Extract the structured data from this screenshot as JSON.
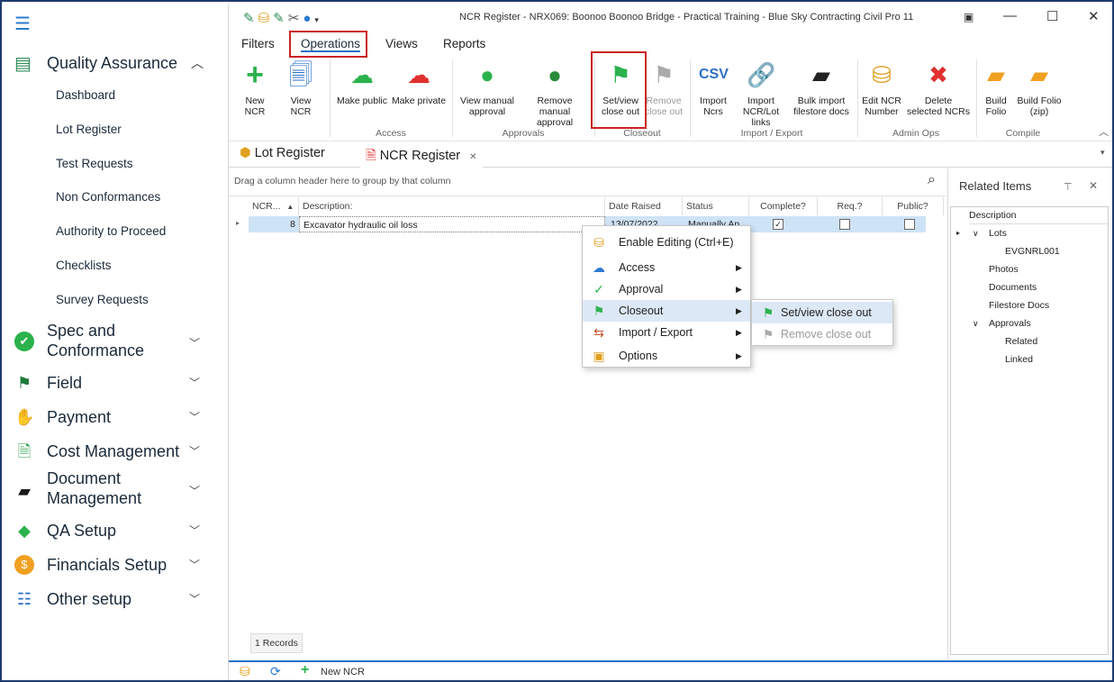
{
  "window": {
    "title": "NCR Register - NRX069: Boonoo Boonoo Bridge - Practical Training - Blue Sky Contracting Civil Pro 11",
    "qat_icons": [
      "edit-icon",
      "db-icon",
      "user-edit-icon",
      "tools-icon",
      "user-icon",
      "dropdown-icon"
    ]
  },
  "sidebar": {
    "section": "Quality Assurance",
    "sub_items": [
      "Dashboard",
      "Lot Register",
      "Test Requests",
      "Non Conformances",
      "Authority to Proceed",
      "Checklists",
      "Survey Requests"
    ],
    "groups": [
      {
        "label": "Spec and\nConformance",
        "label_line1": "Spec and",
        "label_line2": "Conformance",
        "icon": "check-circle-icon"
      },
      {
        "label": "Field",
        "icon": "flag-icon"
      },
      {
        "label": "Payment",
        "icon": "payment-icon"
      },
      {
        "label": "Cost Management",
        "icon": "cost-icon"
      },
      {
        "label": "Document Management",
        "label_line1": "Document",
        "label_line2": "Management",
        "icon": "folder-icon"
      },
      {
        "label": "QA Setup",
        "icon": "tag-icon"
      },
      {
        "label": "Financials Setup",
        "icon": "dollar-icon"
      },
      {
        "label": "Other setup",
        "icon": "settings-list-icon"
      }
    ]
  },
  "ribbon_tabs": [
    "Filters",
    "Operations",
    "Views",
    "Reports"
  ],
  "ribbon": {
    "new_ncr": "New NCR",
    "view_ncr": "View NCR",
    "make_public": "Make public",
    "make_private": "Make private",
    "access_group": "Access",
    "view_manual_approval_1": "View manual",
    "view_manual_approval_2": "approval",
    "remove_manual_approval_1": "Remove manual",
    "remove_manual_approval_2": "approval",
    "approvals_group": "Approvals",
    "set_view_close_out_1": "Set/view",
    "set_view_close_out_2": "close out",
    "remove_close_out_1": "Remove",
    "remove_close_out_2": "close out",
    "closeout_group": "Closeout",
    "import_ncrs_1": "Import",
    "import_ncrs_2": "Ncrs",
    "import_links_1": "Import",
    "import_links_2": "NCR/Lot links",
    "bulk_import_1": "Bulk import",
    "bulk_import_2": "filestore docs",
    "import_export_group": "Import / Export",
    "edit_ncr_1": "Edit NCR",
    "edit_ncr_2": "Number",
    "delete_ncrs_1": "Delete",
    "delete_ncrs_2": "selected NCRs",
    "admin_ops_group": "Admin Ops",
    "build_folio_1": "Build",
    "build_folio_2": "Folio",
    "build_folio_zip_1": "Build Folio",
    "build_folio_zip_2": "(zip)",
    "compile_group": "Compile"
  },
  "doc_tabs": {
    "lot_register": "Lot Register",
    "ncr_register": "NCR Register"
  },
  "grid": {
    "group_hint": "Drag a column header here to group by that column",
    "columns": [
      "NCR...",
      "Description:",
      "Date Raised",
      "Status",
      "Complete?",
      "Req.?",
      "Public?"
    ],
    "rows": [
      {
        "ncr": "8",
        "description": "Excavator hydraulic oil loss",
        "date": "13/07/2022",
        "status": "Manually Ap",
        "complete": true,
        "req": false,
        "public": false
      }
    ],
    "records": "1 Records"
  },
  "related": {
    "title": "Related Items",
    "column": "Description",
    "tree": [
      "Lots",
      "EVGNRL001",
      "Photos",
      "Documents",
      "Filestore Docs",
      "Approvals",
      "Related",
      "Linked"
    ]
  },
  "context_menu": {
    "items": [
      "Enable Editing (Ctrl+E)",
      "Access",
      "Approval",
      "Closeout",
      "Import / Export",
      "Options"
    ],
    "submenu": [
      "Set/view close out",
      "Remove close out"
    ]
  },
  "statusbar": {
    "new_ncr": "New NCR"
  },
  "colors": {
    "accent": "#2b6fc7",
    "highlight": "#cc2222",
    "selected_row": "#cfe3f7"
  }
}
